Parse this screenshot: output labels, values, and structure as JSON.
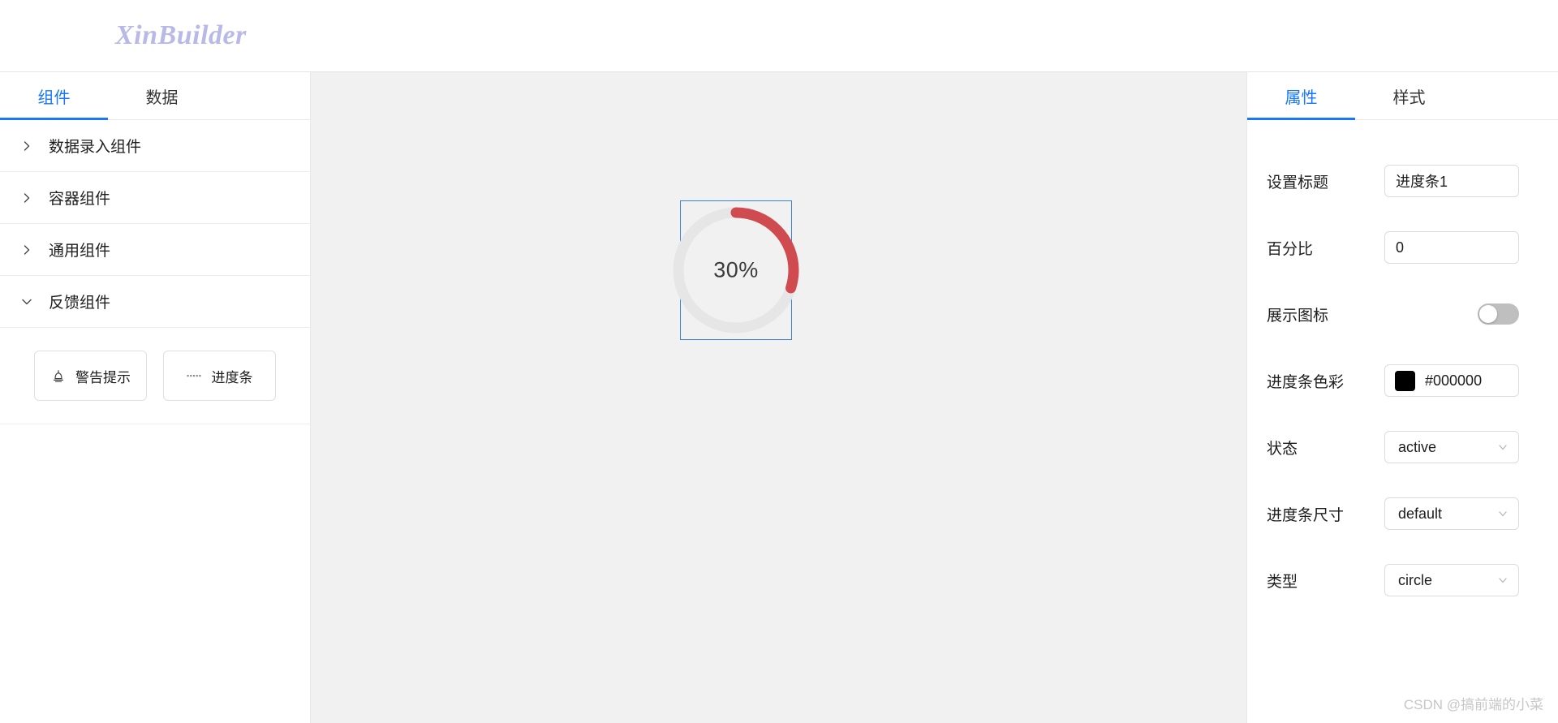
{
  "header": {
    "brand": "XinBuilder"
  },
  "left_panel": {
    "tabs": [
      {
        "label": "组件",
        "active": true
      },
      {
        "label": "数据",
        "active": false
      }
    ],
    "groups": [
      {
        "label": "数据录入组件",
        "expanded": false,
        "icon": "chevron-right-icon"
      },
      {
        "label": "容器组件",
        "expanded": false,
        "icon": "chevron-right-icon"
      },
      {
        "label": "通用组件",
        "expanded": false,
        "icon": "chevron-right-icon"
      },
      {
        "label": "反馈组件",
        "expanded": true,
        "icon": "chevron-down-icon"
      }
    ],
    "components": [
      {
        "label": "警告提示",
        "icon": "alert-siren-icon"
      },
      {
        "label": "进度条",
        "icon": "ellipsis-dots-icon"
      }
    ]
  },
  "canvas": {
    "background": "#f1f1f1",
    "selection_border": "#3b82dc",
    "widget": {
      "type": "circle-progress",
      "percent_label": "30%",
      "percent_value": 30,
      "stroke_color": "#d04b50",
      "track_color": "#e6e6e6"
    }
  },
  "right_panel": {
    "tabs": [
      {
        "label": "属性",
        "active": true
      },
      {
        "label": "样式",
        "active": false
      }
    ],
    "properties": [
      {
        "label": "设置标题",
        "control": "input",
        "value": "进度条1"
      },
      {
        "label": "百分比",
        "control": "input",
        "value": "0"
      },
      {
        "label": "展示图标",
        "control": "switch",
        "value": "off"
      },
      {
        "label": "进度条色彩",
        "control": "color",
        "value": "#000000",
        "swatch": "#000000"
      },
      {
        "label": "状态",
        "control": "select",
        "value": "active"
      },
      {
        "label": "进度条尺寸",
        "control": "select",
        "value": "default"
      },
      {
        "label": "类型",
        "control": "select",
        "value": "circle"
      }
    ]
  },
  "watermark": {
    "text": "CSDN @搞前端的小菜"
  },
  "colors": {
    "accent": "#1677ff",
    "brand": "#b9b9e8",
    "progress": "#d04b50"
  }
}
